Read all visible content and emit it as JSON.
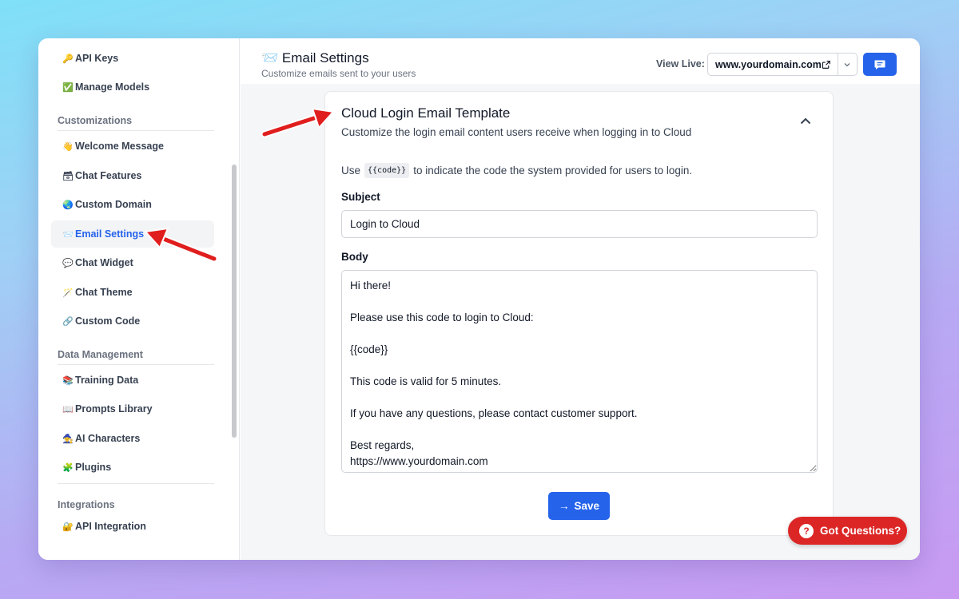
{
  "sidebar": {
    "items": [
      {
        "icon": "🔑",
        "icon_name": "key-icon",
        "label": "API Keys"
      },
      {
        "icon": "✅",
        "icon_name": "check-icon",
        "label": "Manage Models"
      },
      {
        "icon": "👋",
        "icon_name": "wave-icon",
        "label": "Welcome Message"
      },
      {
        "icon": "🗃",
        "icon_name": "card-box-icon",
        "label": "Chat Features"
      },
      {
        "icon": "🌏",
        "icon_name": "globe-icon",
        "label": "Custom Domain"
      },
      {
        "icon": "📨",
        "icon_name": "envelope-icon",
        "label": "Email Settings"
      },
      {
        "icon": "💬",
        "icon_name": "speech-bubble-icon",
        "label": "Chat Widget"
      },
      {
        "icon": "🪄",
        "icon_name": "magic-wand-icon",
        "label": "Chat Theme"
      },
      {
        "icon": "🔗",
        "icon_name": "link-icon",
        "label": "Custom Code"
      },
      {
        "icon": "📚",
        "icon_name": "books-icon",
        "label": "Training Data"
      },
      {
        "icon": "📖",
        "icon_name": "open-book-icon",
        "label": "Prompts Library"
      },
      {
        "icon": "🧙",
        "icon_name": "character-icon",
        "label": "AI Characters"
      },
      {
        "icon": "🧩",
        "icon_name": "puzzle-icon",
        "label": "Plugins"
      },
      {
        "icon": "🔐",
        "icon_name": "lock-key-icon",
        "label": "API Integration"
      }
    ],
    "sections": {
      "customizations": "Customizations",
      "data_management": "Data Management",
      "integrations": "Integrations"
    },
    "active_item": "Email Settings"
  },
  "header": {
    "icon": "📨",
    "title": "Email Settings",
    "subtitle": "Customize emails sent to your users",
    "view_live_label": "View Live:",
    "domain": "www.yourdomain.com"
  },
  "card": {
    "title": "Cloud Login Email Template",
    "subtitle": "Customize the login email content users receive when logging in to Cloud",
    "hint_prefix": "Use",
    "hint_code": "{{code}}",
    "hint_suffix": "to indicate the code the system provided for users to login.",
    "subject_label": "Subject",
    "subject_value": "Login to Cloud",
    "body_label": "Body",
    "body_value": "Hi there!\n\nPlease use this code to login to Cloud:\n\n{{code}}\n\nThis code is valid for 5 minutes.\n\nIf you have any questions, please contact customer support.\n\nBest regards,\nhttps://www.yourdomain.com",
    "save_label": "Save",
    "save_icon": "→"
  },
  "help": {
    "icon": "?",
    "label": "Got Questions?"
  },
  "colors": {
    "accent": "#2563eb",
    "annotation_arrow": "#e01e1e",
    "help_button": "#dc2626"
  }
}
